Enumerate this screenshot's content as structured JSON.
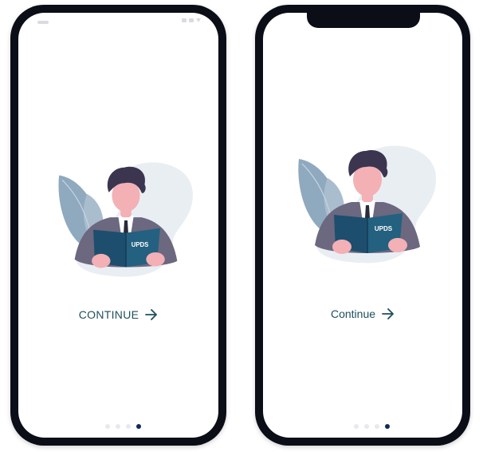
{
  "screens": [
    {
      "cta": {
        "label": "CONTINUE",
        "icon": "arrow-right-icon"
      },
      "book_label": "UPDS",
      "pagination": {
        "total": 4,
        "active_index": 3
      }
    },
    {
      "cta": {
        "label": "Continue",
        "icon": "arrow-right-icon"
      },
      "book_label": "UPDS",
      "pagination": {
        "total": 4,
        "active_index": 3
      }
    }
  ],
  "colors": {
    "accent": "#1f4f5c",
    "dot_active": "#0e2a5a",
    "dot_inactive": "#e7e9ee",
    "phone_frame": "#0b0d17",
    "book": "#1d4e6e",
    "suit": "#6b6880",
    "hair": "#3b3550",
    "skin": "#f3b0b5",
    "leaf": "#8fa9bf",
    "blob": "#e9eef3"
  }
}
